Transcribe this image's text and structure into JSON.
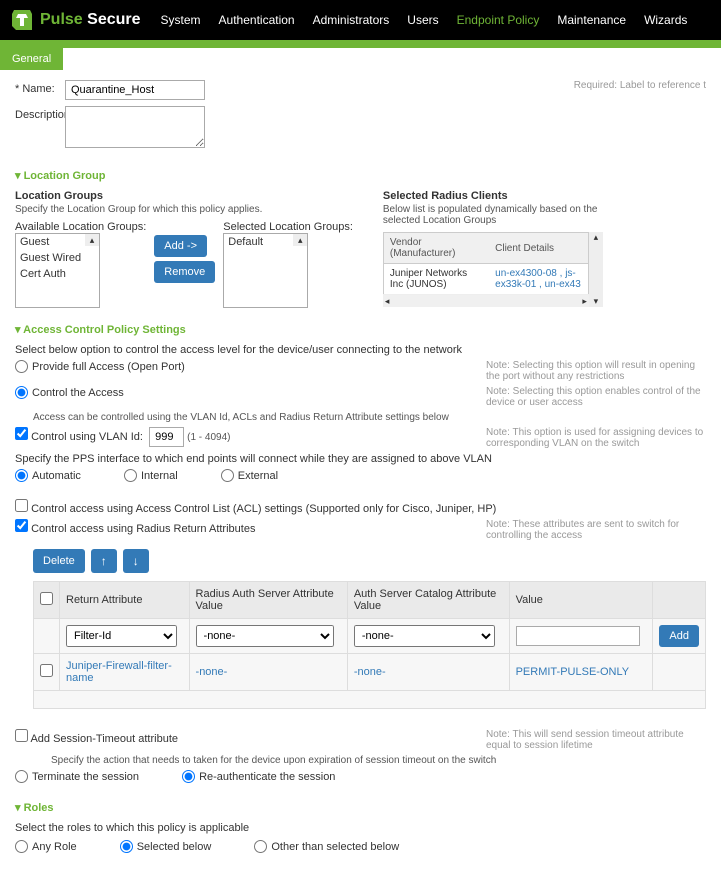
{
  "brand": {
    "pulse": "Pulse",
    "secure": "Secure"
  },
  "nav": {
    "system": "System",
    "authentication": "Authentication",
    "administrators": "Administrators",
    "users": "Users",
    "endpoint_policy": "Endpoint Policy",
    "maintenance": "Maintenance",
    "wizards": "Wizards"
  },
  "tab": {
    "general": "General"
  },
  "form": {
    "name_label": "* Name:",
    "name_value": "Quarantine_Host",
    "desc_label": "Description:",
    "req_note": "Required: Label to reference t"
  },
  "sections": {
    "location": "Location Group",
    "acps": "Access Control Policy Settings",
    "roles": "Roles"
  },
  "location": {
    "heading": "Location Groups",
    "hint": "Specify the Location Group for which this policy applies.",
    "avail_label": "Available Location Groups:",
    "sel_label": "Selected Location Groups:",
    "avail": {
      "i0": "Guest",
      "i1": "Guest Wired",
      "i2": "Cert Auth"
    },
    "selected": {
      "i0": "Default"
    },
    "btn_add": "Add ->",
    "btn_remove": "Remove"
  },
  "radius": {
    "heading": "Selected Radius Clients",
    "hint": "Below list is populated dynamically based on the selected Location Groups",
    "th_vendor": "Vendor (Manufacturer)",
    "th_client": "Client Details",
    "row_vendor": "Juniper Networks Inc (JUNOS)",
    "row_client": "un-ex4300-08 , js-ex33k-01 , un-ex43"
  },
  "acps": {
    "intro": "Select below option to control the access level for the device/user connecting to the network",
    "opt_full": "Provide full Access (Open Port)",
    "opt_full_note": "Note: Selecting this option will result in opening the port without any restrictions",
    "opt_ctrl": "Control the Access",
    "opt_ctrl_note": "Note: Selecting this option enables control of the device or user access",
    "ctrl_hint": "Access can be controlled using the VLAN Id, ACLs and Radius Return Attribute settings below",
    "vlan_label": "Control using VLAN Id:",
    "vlan_value": "999",
    "vlan_range": "(1 - 4094)",
    "vlan_note": "Note: This option is used for assigning devices to corresponding VLAN on the switch",
    "pps_hint": "Specify the PPS interface to which end points will connect while they are assigned to above VLAN",
    "iface_auto": "Automatic",
    "iface_internal": "Internal",
    "iface_external": "External",
    "acl_label": "Control access using Access Control List (ACL) settings (Supported only for Cisco, Juniper, HP)",
    "radattr_label": "Control access using Radius Return Attributes",
    "radattr_note": "Note: These attributes are sent to switch for controlling the access",
    "btn_delete": "Delete",
    "table": {
      "th_return": "Return Attribute",
      "th_radius": "Radius Auth Server Attribute Value",
      "th_catalog": "Auth Server Catalog Attribute Value",
      "th_value": "Value",
      "btn_add": "Add",
      "r1_attr": "Filter-Id",
      "r1_radius": "-none-",
      "r1_catalog": "-none-",
      "r2_attr": "Juniper-Firewall-filter-name",
      "r2_radius": "-none-",
      "r2_catalog": "-none-",
      "r2_value": "PERMIT-PULSE-ONLY"
    },
    "sess_label": "Add Session-Timeout attribute",
    "sess_note": "Note: This will send session timeout attribute equal to session lifetime",
    "sess_hint": "Specify the action that needs to taken for the device upon expiration of session timeout on the switch",
    "sess_term": "Terminate the session",
    "sess_reauth": "Re-authenticate the session"
  },
  "roles": {
    "heading": "Select the roles to which this policy is applicable",
    "any": "Any Role",
    "selected": "Selected below",
    "other": "Other than selected below"
  }
}
